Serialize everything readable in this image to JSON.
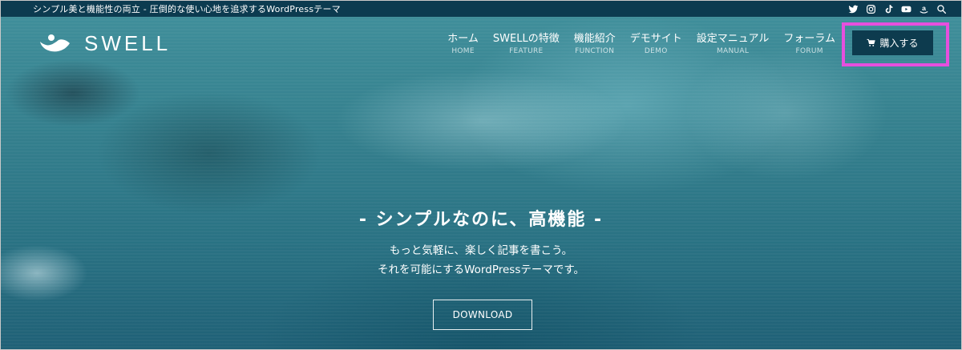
{
  "topbar": {
    "tagline": "シンプル美と機能性の両立 - 圧倒的な使い心地を追求するWordPressテーマ",
    "sns_icons": [
      "twitter-icon",
      "instagram-icon",
      "tiktok-icon",
      "youtube-icon",
      "amazon-icon",
      "search-icon"
    ]
  },
  "header": {
    "logo_text": "SWELL",
    "nav": [
      {
        "ja": "ホーム",
        "en": "HOME"
      },
      {
        "ja": "SWELLの特徴",
        "en": "FEATURE"
      },
      {
        "ja": "機能紹介",
        "en": "FUNCTION"
      },
      {
        "ja": "デモサイト",
        "en": "DEMO"
      },
      {
        "ja": "設定マニュアル",
        "en": "MANUAL"
      },
      {
        "ja": "フォーラム",
        "en": "FORUM"
      }
    ],
    "buy_button": {
      "label": "購入する",
      "icon": "cart-icon"
    }
  },
  "hero": {
    "catch": "- シンプルなのに、高機能 -",
    "lead_line1": "もっと気軽に、楽しく記事を書こう。",
    "lead_line2": "それを可能にするWordPressテーマです。",
    "download_label": "DOWNLOAD"
  },
  "colors": {
    "topbar_bg": "#0c3b50",
    "buy_button_bg": "#0d3b4e",
    "highlight_border": "#e64fde",
    "hero_water": "#2f7787"
  }
}
